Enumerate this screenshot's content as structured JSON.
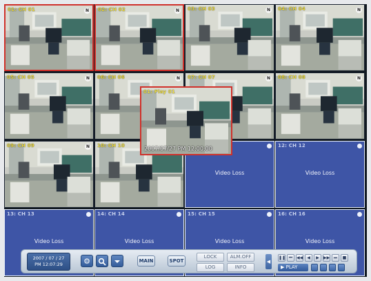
{
  "grid": [
    {
      "label": "01: CH 01",
      "state": "video",
      "selected": true,
      "badges": [
        "rec-icon",
        "rec-icon",
        "n-icon"
      ]
    },
    {
      "label": "02: CH 02",
      "state": "video",
      "selected": true,
      "badges": [
        "n-icon"
      ]
    },
    {
      "label": "03: CH 03",
      "state": "video",
      "selected": false,
      "badges": [
        "n-icon"
      ]
    },
    {
      "label": "04: CH 04",
      "state": "video",
      "selected": false,
      "badges": [
        "n-icon"
      ]
    },
    {
      "label": "05: CH 05",
      "state": "video",
      "selected": false,
      "badges": [
        "n-icon"
      ]
    },
    {
      "label": "06: CH 06",
      "state": "video",
      "selected": false,
      "badges": [
        "n-icon"
      ]
    },
    {
      "label": "07: CH 07",
      "state": "video",
      "selected": false,
      "badges": [
        "n-icon"
      ]
    },
    {
      "label": "08: CH 08",
      "state": "video",
      "selected": false,
      "badges": [
        "n-icon"
      ]
    },
    {
      "label": "09: CH 09",
      "state": "video",
      "selected": false,
      "badges": [
        "n-icon"
      ]
    },
    {
      "label": "10: CH 10",
      "state": "video",
      "selected": false,
      "badges": [
        "n-icon"
      ]
    },
    {
      "label": "11: CH 11",
      "state": "loss",
      "selected": false,
      "badges": [
        "dot-icon"
      ]
    },
    {
      "label": "12: CH 12",
      "state": "loss",
      "selected": false,
      "badges": [
        "dot-icon"
      ]
    },
    {
      "label": "13: CH 13",
      "state": "loss",
      "selected": false,
      "badges": [
        "dot-icon"
      ]
    },
    {
      "label": "14: CH 14",
      "state": "loss",
      "selected": false,
      "badges": [
        "dot-icon"
      ]
    },
    {
      "label": "15: CH 15",
      "state": "loss",
      "selected": false,
      "badges": [
        "dot-icon"
      ]
    },
    {
      "label": "16: CH 16",
      "state": "loss",
      "selected": false,
      "badges": [
        "dot-icon"
      ]
    }
  ],
  "video_loss_text": "Video Loss",
  "popup": {
    "label": "01: Play 01",
    "timestamp": "2007/07/27 PM 12:00:00"
  },
  "controls": {
    "date": "2007 / 07 / 27",
    "time": "PM 12:07:29",
    "main_label": "MAIN",
    "spot_label": "SPOT",
    "lock_label": "LOCK",
    "alm_off_label": "ALM.OFF",
    "log_label": "LOG",
    "info_label": "INFO",
    "play_label": "▶ PLAY",
    "icons": [
      "gear-icon",
      "search-icon",
      "chevron-down-icon"
    ],
    "playback_icons": [
      "pause-icon",
      "skip-start-icon",
      "rewind-icon",
      "step-back-icon",
      "step-forward-icon",
      "fast-forward-icon",
      "skip-end-icon",
      "stop-icon"
    ]
  },
  "colors": {
    "selected_border": "#d0302a",
    "video_loss_bg": "#3e55a6",
    "label_yellow": "#e8d63a"
  }
}
